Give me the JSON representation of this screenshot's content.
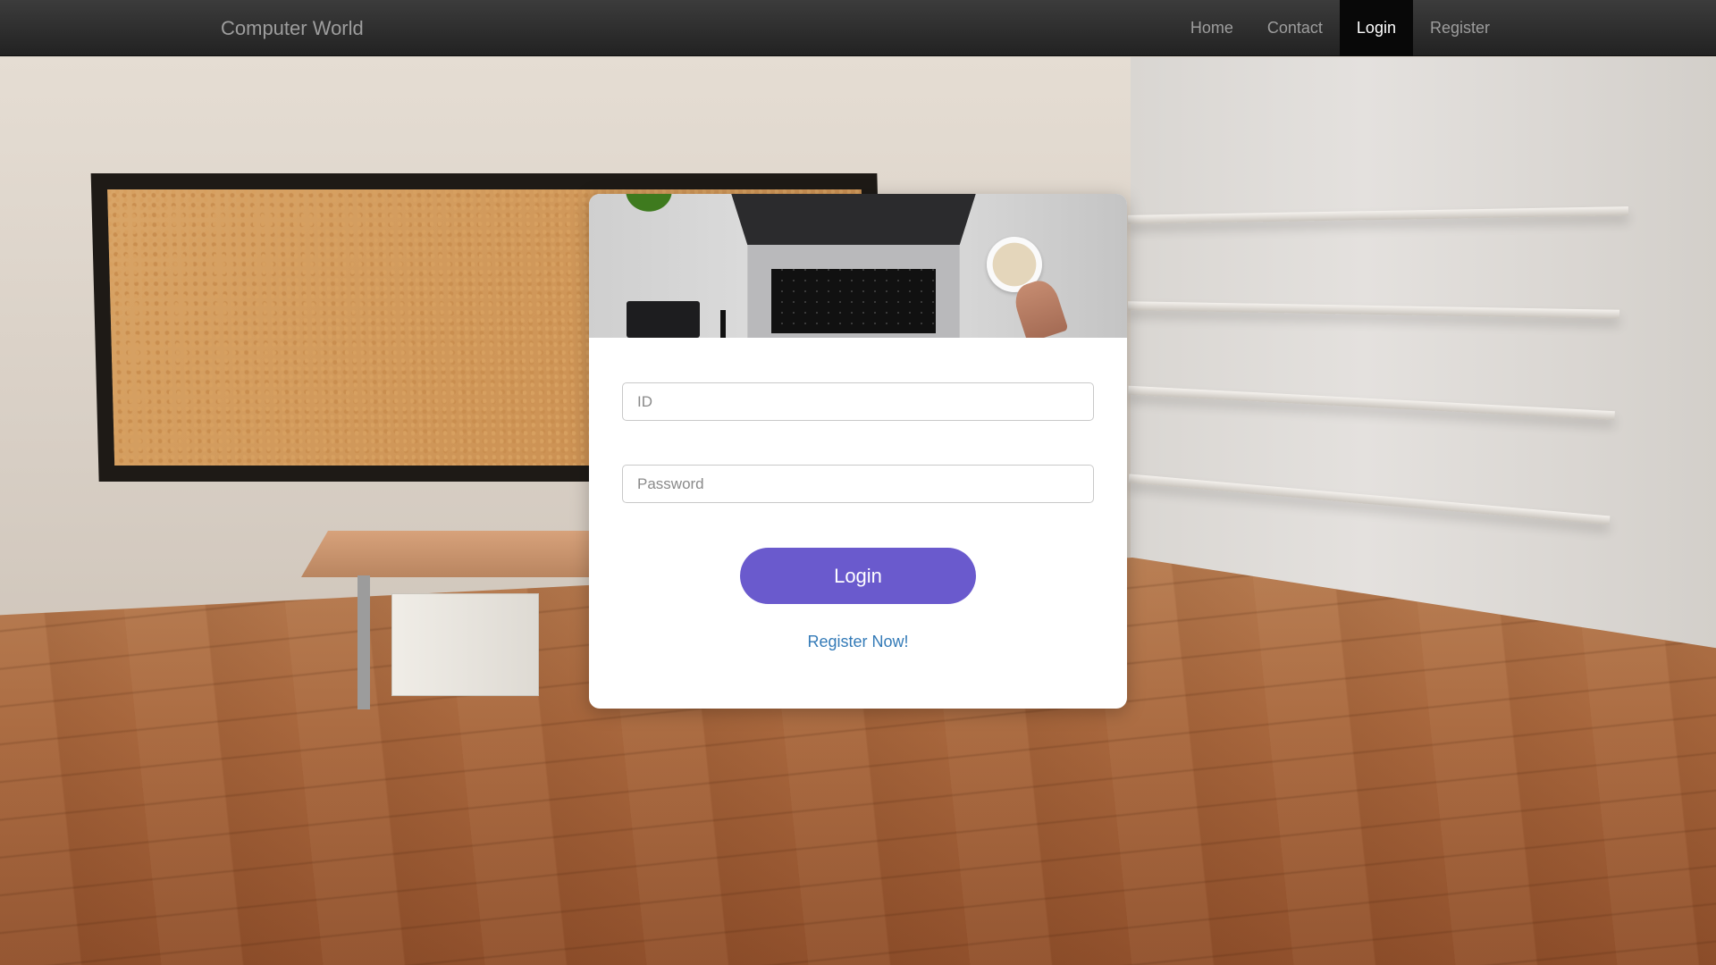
{
  "navbar": {
    "brand": "Computer World",
    "items": [
      {
        "label": "Home",
        "active": false
      },
      {
        "label": "Contact",
        "active": false
      },
      {
        "label": "Login",
        "active": true
      },
      {
        "label": "Register",
        "active": false
      }
    ]
  },
  "login_form": {
    "id_placeholder": "ID",
    "password_placeholder": "Password",
    "submit_label": "Login",
    "register_link": "Register Now!"
  },
  "colors": {
    "navbar_bg": "#222222",
    "accent_button": "#6a5acd",
    "link": "#337ab7"
  },
  "icons": {
    "header_photo": "desk-laptop-photo",
    "background": "office-room-background"
  }
}
